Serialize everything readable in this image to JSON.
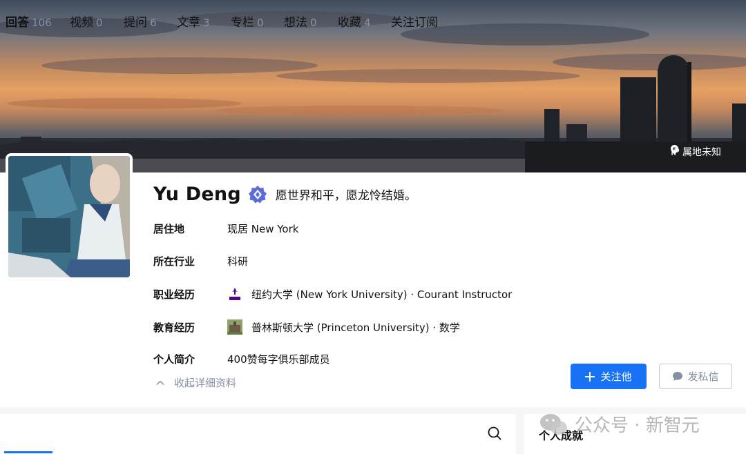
{
  "cover": {
    "ip_location": "IP 属地未知"
  },
  "profile": {
    "name": "Yu Deng",
    "headline": "愿世界和平，愿龙怜结婚。",
    "details": [
      {
        "label": "居住地",
        "value": "现居 New York"
      },
      {
        "label": "所在行业",
        "value": "科研"
      },
      {
        "label": "职业经历",
        "value": "纽约大学 (New York University) · Courant Instructor",
        "logo": "nyu-logo"
      },
      {
        "label": "教育经历",
        "value": "普林斯顿大学 (Princeton University) · 数学",
        "logo": "princeton-logo"
      },
      {
        "label": "个人简介",
        "value": "400赞每字俱乐部成员"
      }
    ],
    "collapse_label": "收起详细资料"
  },
  "actions": {
    "follow_label": "关注他",
    "message_label": "发私信"
  },
  "tabs": [
    {
      "label": "回答",
      "count": "106"
    },
    {
      "label": "视频",
      "count": "0"
    },
    {
      "label": "提问",
      "count": "6"
    },
    {
      "label": "文章",
      "count": "3"
    },
    {
      "label": "专栏",
      "count": "0"
    },
    {
      "label": "想法",
      "count": "0"
    },
    {
      "label": "收藏",
      "count": "4"
    },
    {
      "label": "关注订阅",
      "count": ""
    }
  ],
  "sidebar": {
    "title": "个人成就"
  },
  "watermark": "公众号 · 新智元",
  "colors": {
    "primary": "#1772f6",
    "muted": "#8590a6",
    "badge": "#5a6dd8",
    "nyu": "#57068c"
  }
}
